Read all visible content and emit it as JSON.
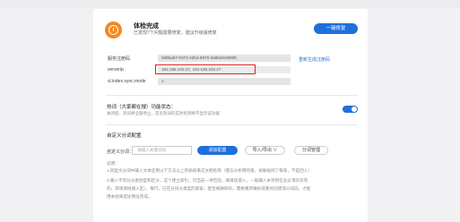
{
  "status": {
    "title": "体检完成",
    "subtitle": "已发现7个问题需要修复，建议升级版修复",
    "repair_button": "一键修复"
  },
  "fields": [
    {
      "label": "服务注册码",
      "value": "0d6ba97-0372-42b4-8979-3a6be5c969f5"
    },
    {
      "label": "serverip",
      "value": "192.168.225.27, 192.168.225.27"
    },
    {
      "label": "sl.index.sync.mode",
      "value": "1"
    }
  ],
  "reset_link": "重新生成注册码",
  "hot_words": {
    "title": "热词（大家都在搜）功能状态：",
    "description": "关闭后，热词将全部停止，首页热词的实时检测将不显示该功能",
    "enabled": true
  },
  "custom_categories": {
    "title": "自定义分词配置",
    "filter_label": "自定义分词：",
    "input_placeholder": "请输入关键词语",
    "add_button": "添加配置",
    "import_button": "导入/导出 ∨",
    "manage_button": "分词管理",
    "notes_title": "说明：",
    "notes": [
      "1.同型文分词中输入文本应用以下方法以上有损耗来这文明名称（使与分析明的值，关联规则了每等，不是回入）",
      "2.输入不同分分类别型和区分，这个建立索引，可当前一项包括，填请该值入，一般输入本项所在业必须仅符有",
      "的，等请请给输入区），每行，已在分词分类型的索索，配合被删除的，需要重新做好成要的创建或分词向，才能",
      "用本组来提达网址完成。"
    ]
  },
  "colors": {
    "accent": "#1f6fdc",
    "warning": "#f28a1e",
    "highlight": "#e02424"
  }
}
